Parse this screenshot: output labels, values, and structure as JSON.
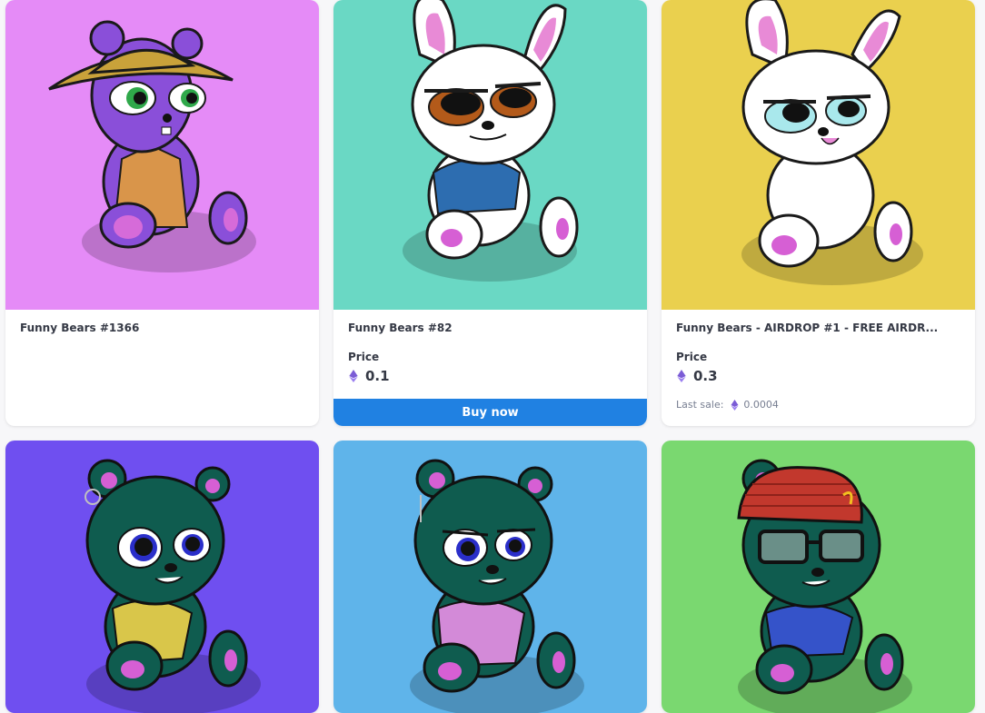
{
  "cards": [
    {
      "name": "Funny Bears #1366",
      "background": "#e58bf7",
      "character": "purple-bear-with-yellow-bucket-hat",
      "price_label": "",
      "price": "",
      "last_sale_label": "",
      "last_sale": "",
      "buy_label": ""
    },
    {
      "name": "Funny Bears #82",
      "background": "#6ad8c4",
      "character": "white-bunny-with-blue-shirt",
      "price_label": "Price",
      "price": "0.1",
      "last_sale_label": "",
      "last_sale": "",
      "buy_label": "Buy now"
    },
    {
      "name": "Funny Bears - AIRDROP #1 - FREE AIRDR...",
      "background": "#ead04e",
      "character": "white-bunny-with-chain",
      "price_label": "Price",
      "price": "0.3",
      "last_sale_label": "Last sale:",
      "last_sale": "0.0004",
      "buy_label": ""
    },
    {
      "name": "",
      "background": "#6f4ff0",
      "character": "teal-bear-with-yellow-shirt-and-earring",
      "price_label": "",
      "price": "",
      "last_sale_label": "",
      "last_sale": "",
      "buy_label": ""
    },
    {
      "name": "",
      "background": "#5fb4ea",
      "character": "teal-bear-with-pink-shirt-and-earring",
      "price_label": "",
      "price": "",
      "last_sale_label": "",
      "last_sale": "",
      "buy_label": ""
    },
    {
      "name": "",
      "background": "#7ad870",
      "character": "teal-bear-with-red-beanie-and-glasses",
      "price_label": "",
      "price": "",
      "last_sale_label": "",
      "last_sale": "",
      "buy_label": ""
    }
  ],
  "colors": {
    "buy_button": "#2081e2",
    "eth_icon": "#7b5cd6",
    "text_primary": "#353945",
    "text_secondary": "#777e91"
  }
}
